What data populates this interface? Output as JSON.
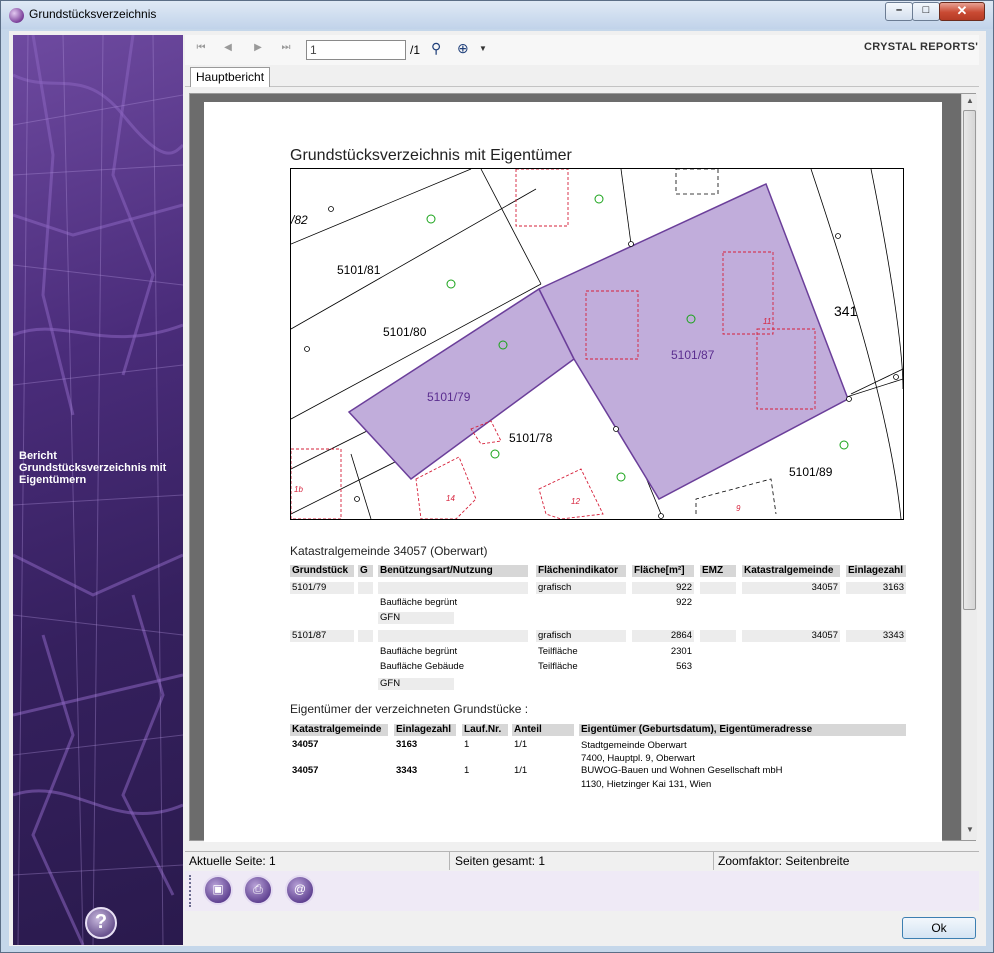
{
  "window": {
    "title": "Grundstücksverzeichnis"
  },
  "sidebar": {
    "label": "Bericht Grundstücksverzeichnis mit Eigentümern",
    "help": "?"
  },
  "toolbar": {
    "page_value": "1",
    "page_total": "/1",
    "brand": "CRYSTAL REPORTS'"
  },
  "tabs": [
    {
      "label": "Hauptbericht"
    }
  ],
  "report": {
    "title": "Grundstücksverzeichnis mit Eigentümer",
    "map_labels": {
      "l1": "/82",
      "l2": "5101/81",
      "l3": "5101/80",
      "l4": "5101/79",
      "l5": "5101/87",
      "l6": "5101/78",
      "l7": "5101/89",
      "l8": "341",
      "l9": "1b",
      "l10": "14",
      "l11": "12",
      "l12": "9",
      "l13": "11"
    },
    "section1": "Katastralgemeinde 34057 (Oberwart)",
    "t1": {
      "headers": [
        "Grundstück",
        "G",
        "Benützungsart/Nutzung",
        "Flächenindikator",
        "Fläche[m²]",
        "EMZ",
        "Katastralgemeinde",
        "Einlagezahl"
      ],
      "r1": {
        "gst": "5101/79",
        "fi": "grafisch",
        "fl": "922",
        "kg": "34057",
        "ez": "3163"
      },
      "r1a": {
        "n": "Baufläche begrünt",
        "fl": "922"
      },
      "r1b": {
        "n": "GFN"
      },
      "r2": {
        "gst": "5101/87",
        "fi": "grafisch",
        "fl": "2864",
        "kg": "34057",
        "ez": "3343"
      },
      "r2a": {
        "n": "Baufläche begrünt",
        "fi": "Teilfläche",
        "fl": "2301"
      },
      "r2b": {
        "n": "Baufläche Gebäude",
        "fi": "Teilfläche",
        "fl": "563"
      },
      "r2c": {
        "n": "GFN"
      }
    },
    "section2": "Eigentümer der verzeichneten Grundstücke :",
    "t2": {
      "headers": [
        "Katastralgemeinde",
        "Einlagezahl",
        "Lauf.Nr.",
        "Anteil",
        "Eigentümer (Geburtsdatum), Eigentümeradresse"
      ],
      "o1": {
        "kg": "34057",
        "ez": "3163",
        "lnr": "1",
        "ant": "1/1",
        "name": "Stadtgemeinde Oberwart",
        "addr": "7400, Hauptpl. 9, Oberwart"
      },
      "o2": {
        "kg": "34057",
        "ez": "3343",
        "lnr": "1",
        "ant": "1/1",
        "name": "BUWOG-Bauen und Wohnen Gesellschaft mbH",
        "addr": "1130, Hietzinger Kai 131, Wien"
      }
    }
  },
  "status": {
    "current": "Aktuelle Seite: 1",
    "total": "Seiten gesamt: 1",
    "zoom": "Zoomfaktor: Seitenbreite"
  },
  "buttons": {
    "ok": "Ok"
  },
  "colors": {
    "accent": "#4a2c7a",
    "parcel_fill": "#c1addb",
    "parcel_stroke": "#6b3f9a"
  }
}
